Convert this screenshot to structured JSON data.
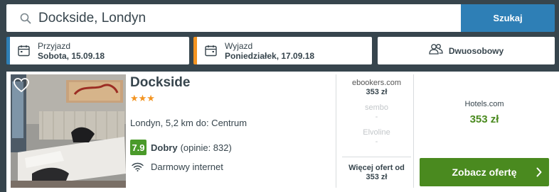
{
  "search": {
    "query": "Dockside, Londyn",
    "button_label": "Szukaj"
  },
  "checkin": {
    "label": "Przyjazd",
    "value": "Sobota, 15.09.18"
  },
  "checkout": {
    "label": "Wyjazd",
    "value": "Poniedziałek, 17.09.18"
  },
  "rooms": {
    "label": "Dwuosobowy"
  },
  "hotel": {
    "name": "Dockside",
    "stars": "★★★",
    "star_count": 3,
    "location": "Londyn, 5,2 km do: Centrum",
    "rating_score": "7.9",
    "rating_word": "Dobry",
    "rating_reviews": "(opinie: 832)",
    "amenity": "Darmowy internet"
  },
  "deals": [
    {
      "site": "ebookers.com",
      "price": "353 zł"
    },
    {
      "site": "sembo",
      "price": "-"
    },
    {
      "site": "Elvoline",
      "price": "-"
    }
  ],
  "more_offers": {
    "line1": "Więcej ofert od",
    "line2": "353 zł"
  },
  "best_offer": {
    "site": "Hotels.com",
    "price": "353 zł",
    "cta_label": "Zobacz ofertę"
  },
  "colors": {
    "background": "#37454d",
    "primary_blue": "#2e7fb6",
    "accent_orange": "#f39421",
    "cta_green": "#4a8a1f",
    "rating_green": "#4a9a2a"
  }
}
